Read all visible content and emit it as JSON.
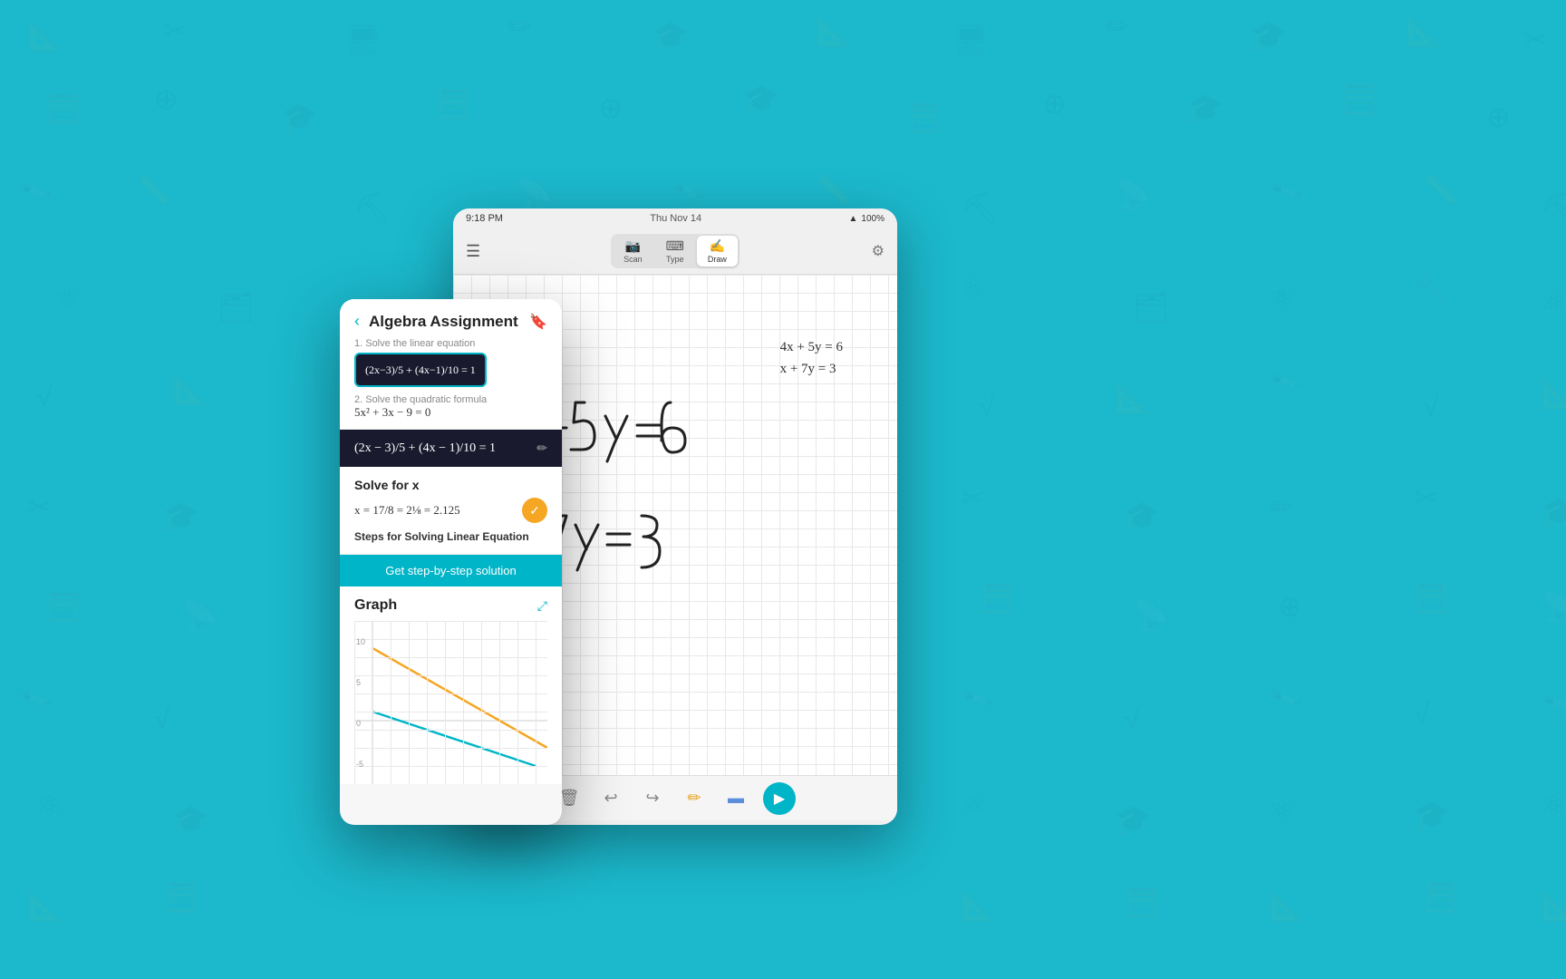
{
  "background": {
    "color": "#00b5c8"
  },
  "ipad": {
    "statusbar": {
      "time": "9:18 PM",
      "date": "Thu Nov 14",
      "battery": "100%",
      "wifi": "WiFi"
    },
    "toolbar": {
      "scan_label": "Scan",
      "type_label": "Type",
      "draw_label": "Draw"
    },
    "typed_equations": {
      "line1": "4x + 5y = 6",
      "line2": "x + 7y = 3"
    },
    "handwritten": {
      "eq1": "4x+5y=6",
      "eq2": "x+7y=3"
    }
  },
  "panel": {
    "back_label": "‹",
    "title": "Algebra Assignment",
    "bookmark_icon": "🔖",
    "step1_label": "1. Solve the linear equation",
    "equation_display": "(2x−3)/5 + (4x−1)/10 = 1",
    "step2_label": "2. Solve the quadratic formula",
    "eq2_text": "5x² + 3x − 9 = 0",
    "selected_equation": "(2x − 3)/5 + (4x − 1)/10 = 1",
    "edit_icon": "✏",
    "solve_title": "Solve for x",
    "solve_result": "x = 17/8 = 2⅛ = 2.125",
    "check_icon": "✓",
    "steps_label": "Steps for Solving Linear Equation",
    "get_steps_btn": "Get step-by-step solution",
    "graph_title": "Graph",
    "graph_expand_icon": "⤢",
    "graph_y_labels": [
      "10",
      "5",
      "0",
      "-5"
    ]
  }
}
